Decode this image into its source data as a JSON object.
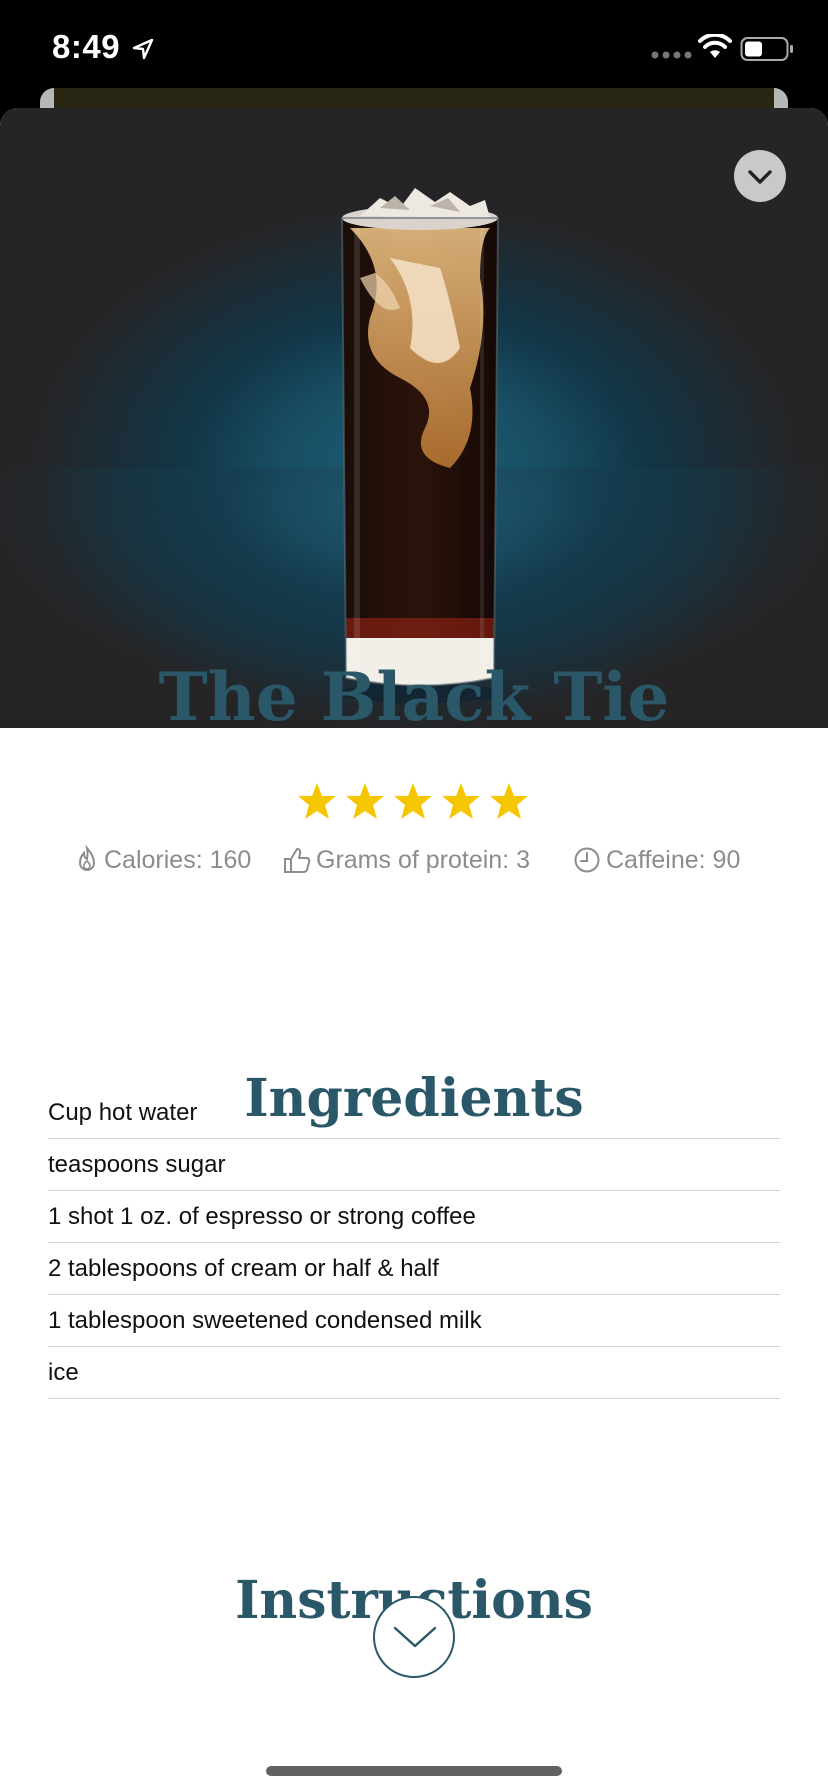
{
  "status_bar": {
    "time": "8:49"
  },
  "recipe": {
    "title": "The Black Tie",
    "rating": 5,
    "stats": {
      "calories": "Calories: 160",
      "protein": "Grams of protein: 3",
      "caffeine": "Caffeine: 90"
    }
  },
  "ingredients": {
    "heading": "Ingredients",
    "items": [
      "Cup hot water",
      "teaspoons sugar",
      "1 shot 1 oz. of espresso or strong coffee",
      "2 tablespoons of cream or half & half",
      "1 tablespoon sweetened condensed milk",
      "ice"
    ]
  },
  "instructions": {
    "heading": "Instructions"
  },
  "colors": {
    "heading": "#2a5869",
    "star": "#f6c700",
    "stat_text": "#8c8c8c",
    "hero_bg": "#252527"
  },
  "icons": [
    "location-arrow-icon",
    "cellular-signal-icon",
    "wifi-icon",
    "battery-icon",
    "chevron-down-icon",
    "flame-icon",
    "thumbs-up-icon",
    "clock-icon",
    "star-icon"
  ]
}
